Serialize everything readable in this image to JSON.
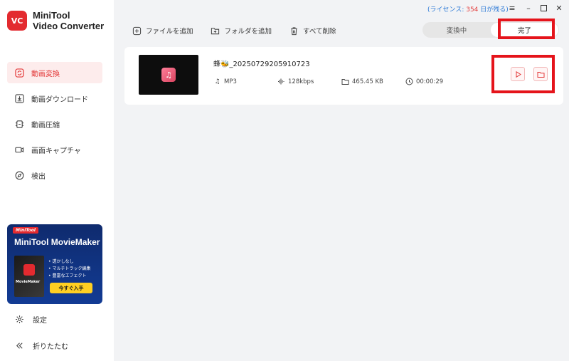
{
  "app": {
    "name_line1": "MiniTool",
    "name_line2": "Video Converter",
    "logo_text": "VC"
  },
  "sidebar": {
    "items": [
      {
        "label": "動画変換",
        "icon": "convert-icon"
      },
      {
        "label": "動画ダウンロード",
        "icon": "download-icon"
      },
      {
        "label": "動画圧縮",
        "icon": "compress-icon"
      },
      {
        "label": "画面キャプチャ",
        "icon": "camera-icon"
      },
      {
        "label": "検出",
        "icon": "compass-icon"
      }
    ],
    "settings_label": "設定",
    "collapse_label": "折りたたむ"
  },
  "promo": {
    "tag": "MiniTool",
    "title": "MiniTool MovieMaker",
    "box_label": "MovieMaker",
    "features": [
      "• 透かしなし",
      "• マルチトラック編集",
      "• 豊富なエフェクト"
    ],
    "button": "今すぐ入手"
  },
  "license": {
    "prefix": "(ライセンス: ",
    "count": "354",
    "suffix": " 日が残る)"
  },
  "toolbar": {
    "add_file": "ファイルを追加",
    "add_folder": "フォルダを追加",
    "delete_all": "すべて削除"
  },
  "tabs": {
    "converting": "変換中",
    "done": "完了"
  },
  "file": {
    "name": "蜂🐝_20250729205910723",
    "format": "MP3",
    "bitrate": "128kbps",
    "size": "465.45 KB",
    "duration": "00:00:29"
  },
  "colors": {
    "accent": "#e33a3a",
    "license_link": "#2a78d6",
    "highlight_box": "#e5141b",
    "promo_bg": "#123b94",
    "promo_button": "#ffcf22"
  }
}
